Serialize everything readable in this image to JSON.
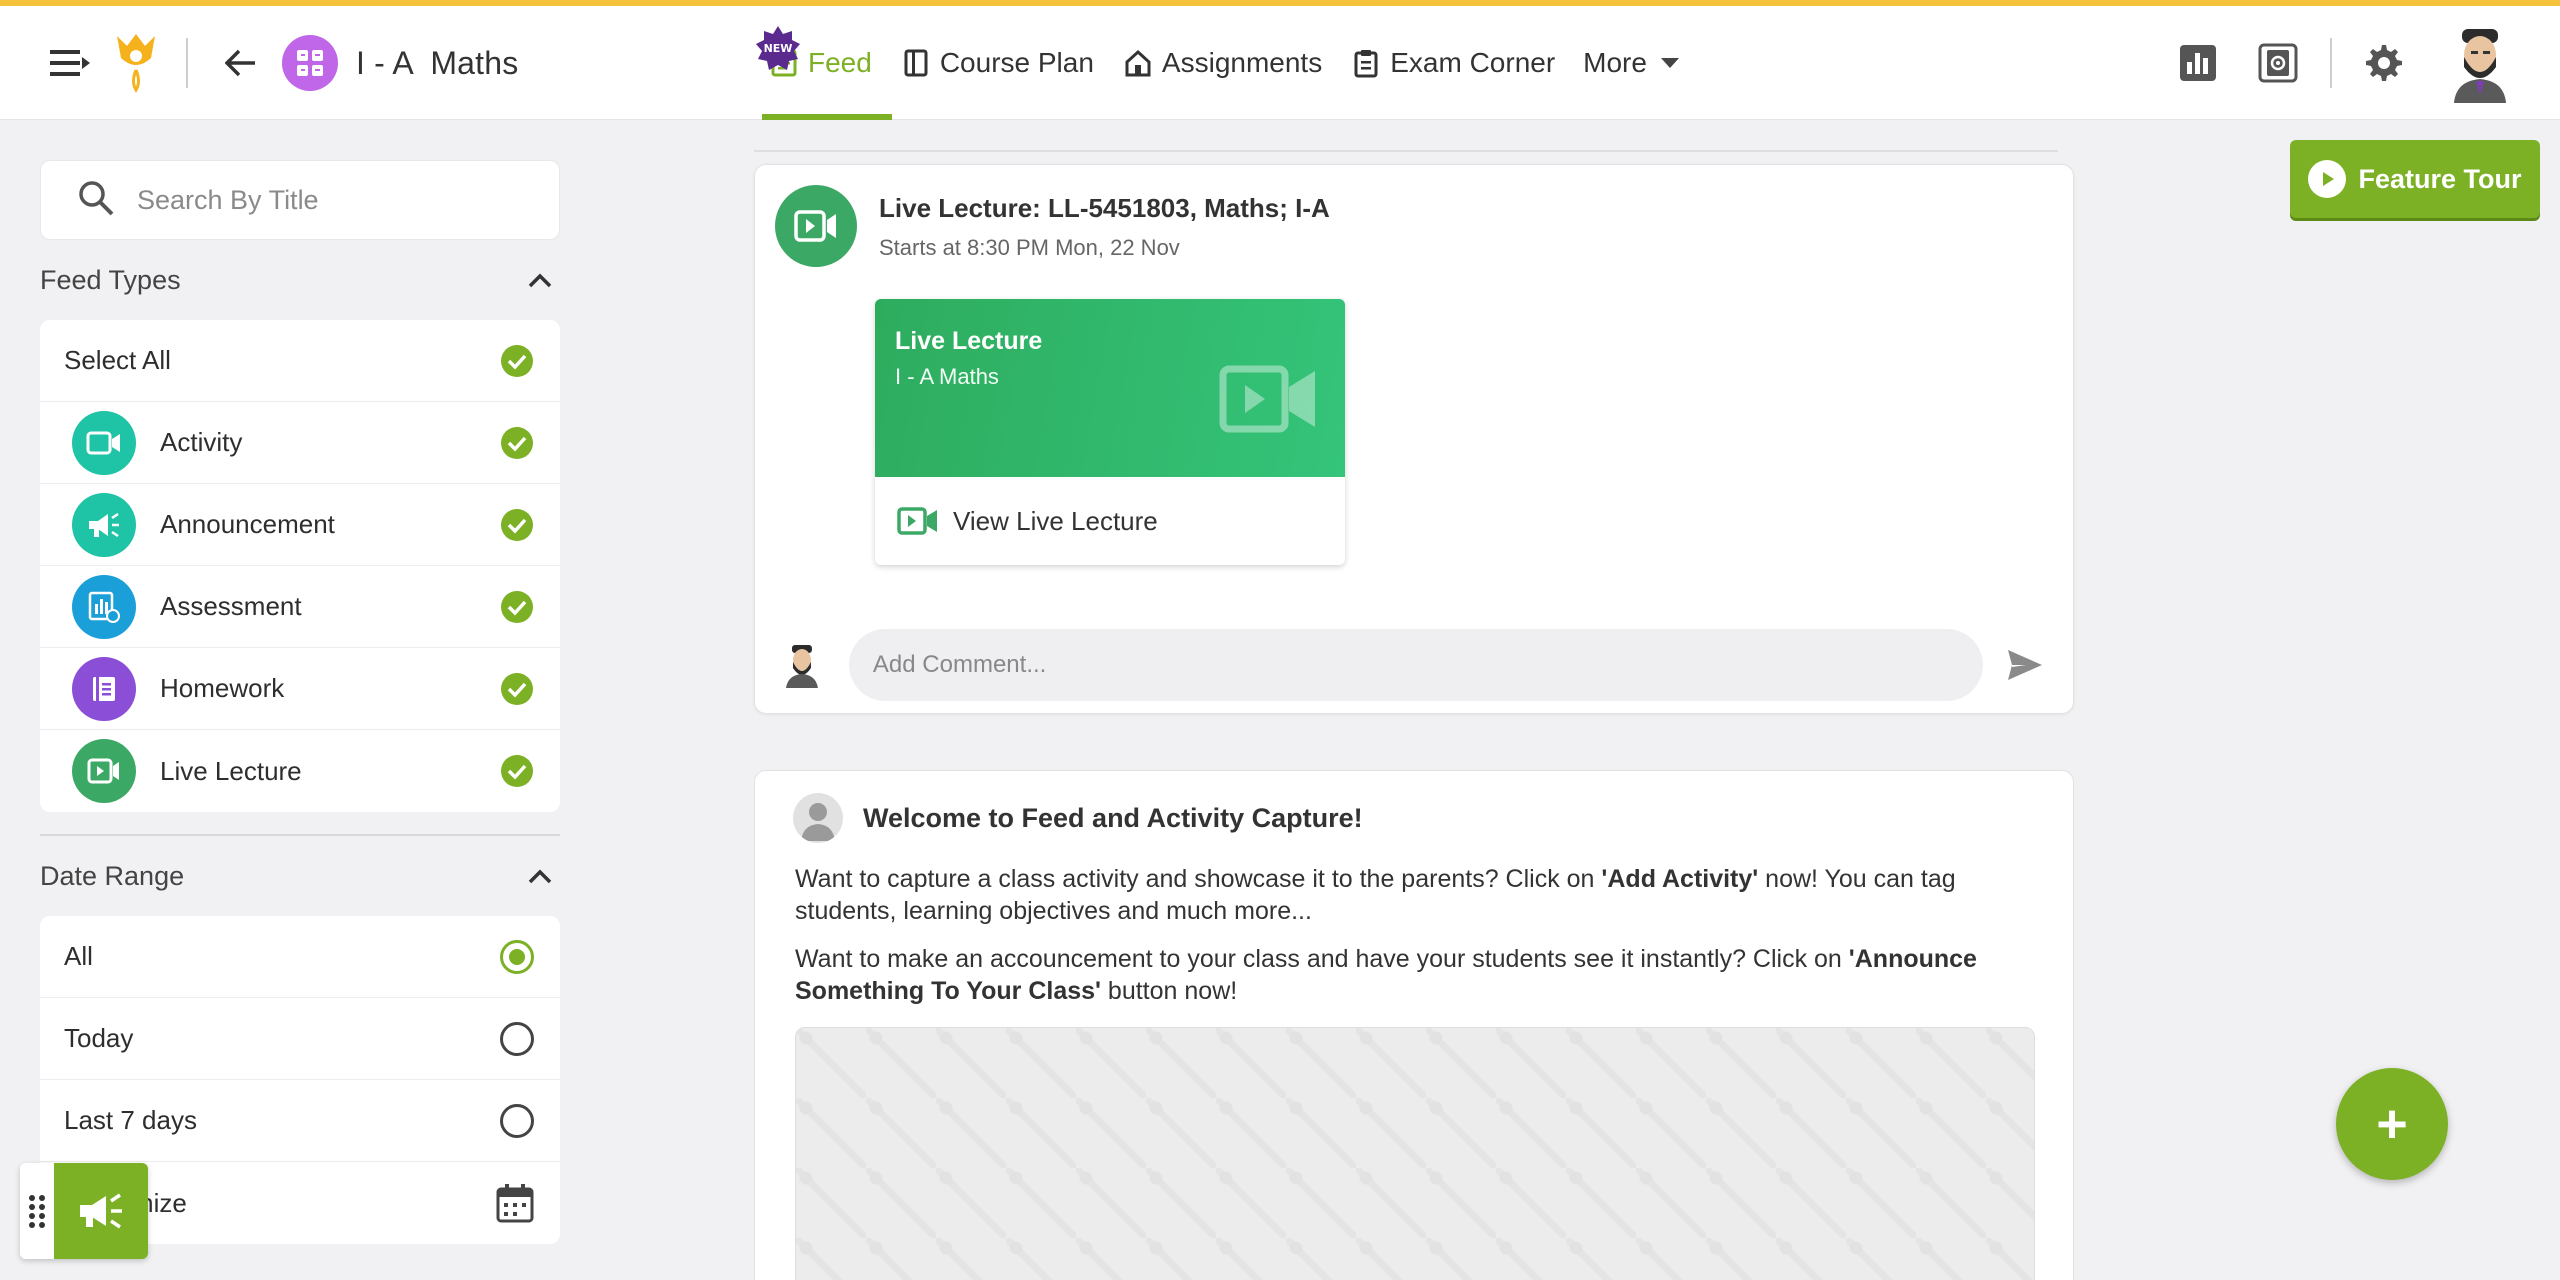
{
  "header": {
    "class_title": "I - A  Maths",
    "nav": [
      {
        "label": "Feed",
        "icon": "feed-icon",
        "active": true
      },
      {
        "label": "Course Plan",
        "icon": "book-icon"
      },
      {
        "label": "Assignments",
        "icon": "home-icon"
      },
      {
        "label": "Exam Corner",
        "icon": "clipboard-icon"
      },
      {
        "label": "More",
        "icon": "chevron-down-icon"
      }
    ],
    "new_badge": "NEW",
    "accent_color": "#7cb025"
  },
  "sidebar": {
    "search_placeholder": "Search By Title",
    "feed_types_title": "Feed Types",
    "select_all": "Select All",
    "feed_types": [
      {
        "label": "Activity",
        "color": "#1fc3a6"
      },
      {
        "label": "Announcement",
        "color": "#1fc3a6"
      },
      {
        "label": "Assessment",
        "color": "#1b9fd8"
      },
      {
        "label": "Homework",
        "color": "#8a4fd6"
      },
      {
        "label": "Live Lecture",
        "color": "#3ca865"
      }
    ],
    "date_range_title": "Date Range",
    "date_ranges": [
      {
        "label": "All",
        "selected": true
      },
      {
        "label": "Today",
        "selected": false
      },
      {
        "label": "Last 7 days",
        "selected": false
      },
      {
        "label": "Customize",
        "selected": false
      }
    ]
  },
  "post": {
    "title": "Live Lecture: LL-5451803, Maths; I-A",
    "subtitle": "Starts at 8:30 PM Mon, 22 Nov",
    "card_title": "Live Lecture",
    "card_class": "I - A Maths",
    "view_label": "View Live Lecture",
    "comment_placeholder": "Add Comment..."
  },
  "welcome": {
    "title": "Welcome to Feed and Activity Capture!",
    "p1_a": "Want to capture a class activity and showcase it to the parents? Click on ",
    "p1_b": "'Add Activity'",
    "p1_c": " now! You can tag students, learning objectives and much more...",
    "p2_a": "Want to make an accouncement to your class and have your students see it instantly? Click on ",
    "p2_b": "'Announce Something To Your Class'",
    "p2_c": " button now!"
  },
  "feature_tour": "Feature Tour",
  "fab_label": "+"
}
